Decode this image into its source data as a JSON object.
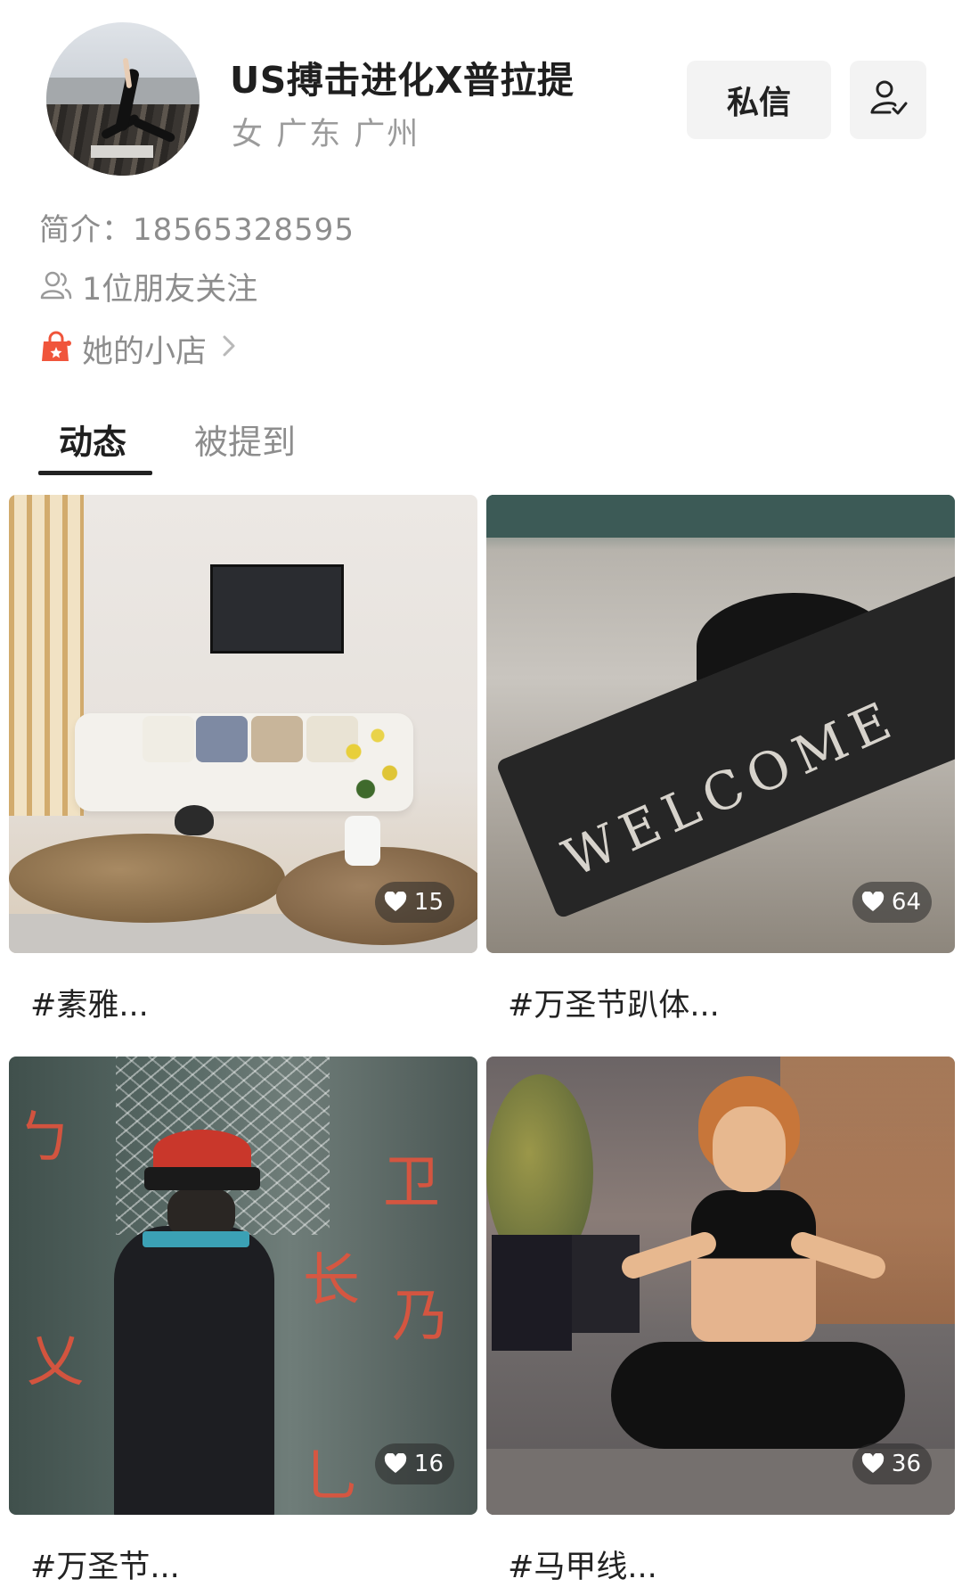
{
  "profile": {
    "name": "US搏击进化X普拉提",
    "meta": "女 广东 广州",
    "bio": "简介：18565328595",
    "friends": "1位朋友关注",
    "shop": "她的小店",
    "message_button": "私信",
    "follow_icon": "follow-user-check-icon"
  },
  "tabs": [
    {
      "label": "动态",
      "active": true
    },
    {
      "label": "被提到",
      "active": false
    }
  ],
  "posts": [
    {
      "caption": "#素雅...",
      "likes": "15"
    },
    {
      "caption": "#万圣节趴体...",
      "likes": "64"
    },
    {
      "caption": "#万圣节...",
      "likes": "16"
    },
    {
      "caption": "#马甲线...",
      "likes": "36"
    }
  ],
  "post_images": {
    "card2_sign": "WELCOME"
  },
  "colors": {
    "text_primary": "#1f1f1f",
    "text_secondary": "#8d8d8d",
    "button_bg": "#f3f3f3",
    "shop_icon": "#f0553b"
  }
}
